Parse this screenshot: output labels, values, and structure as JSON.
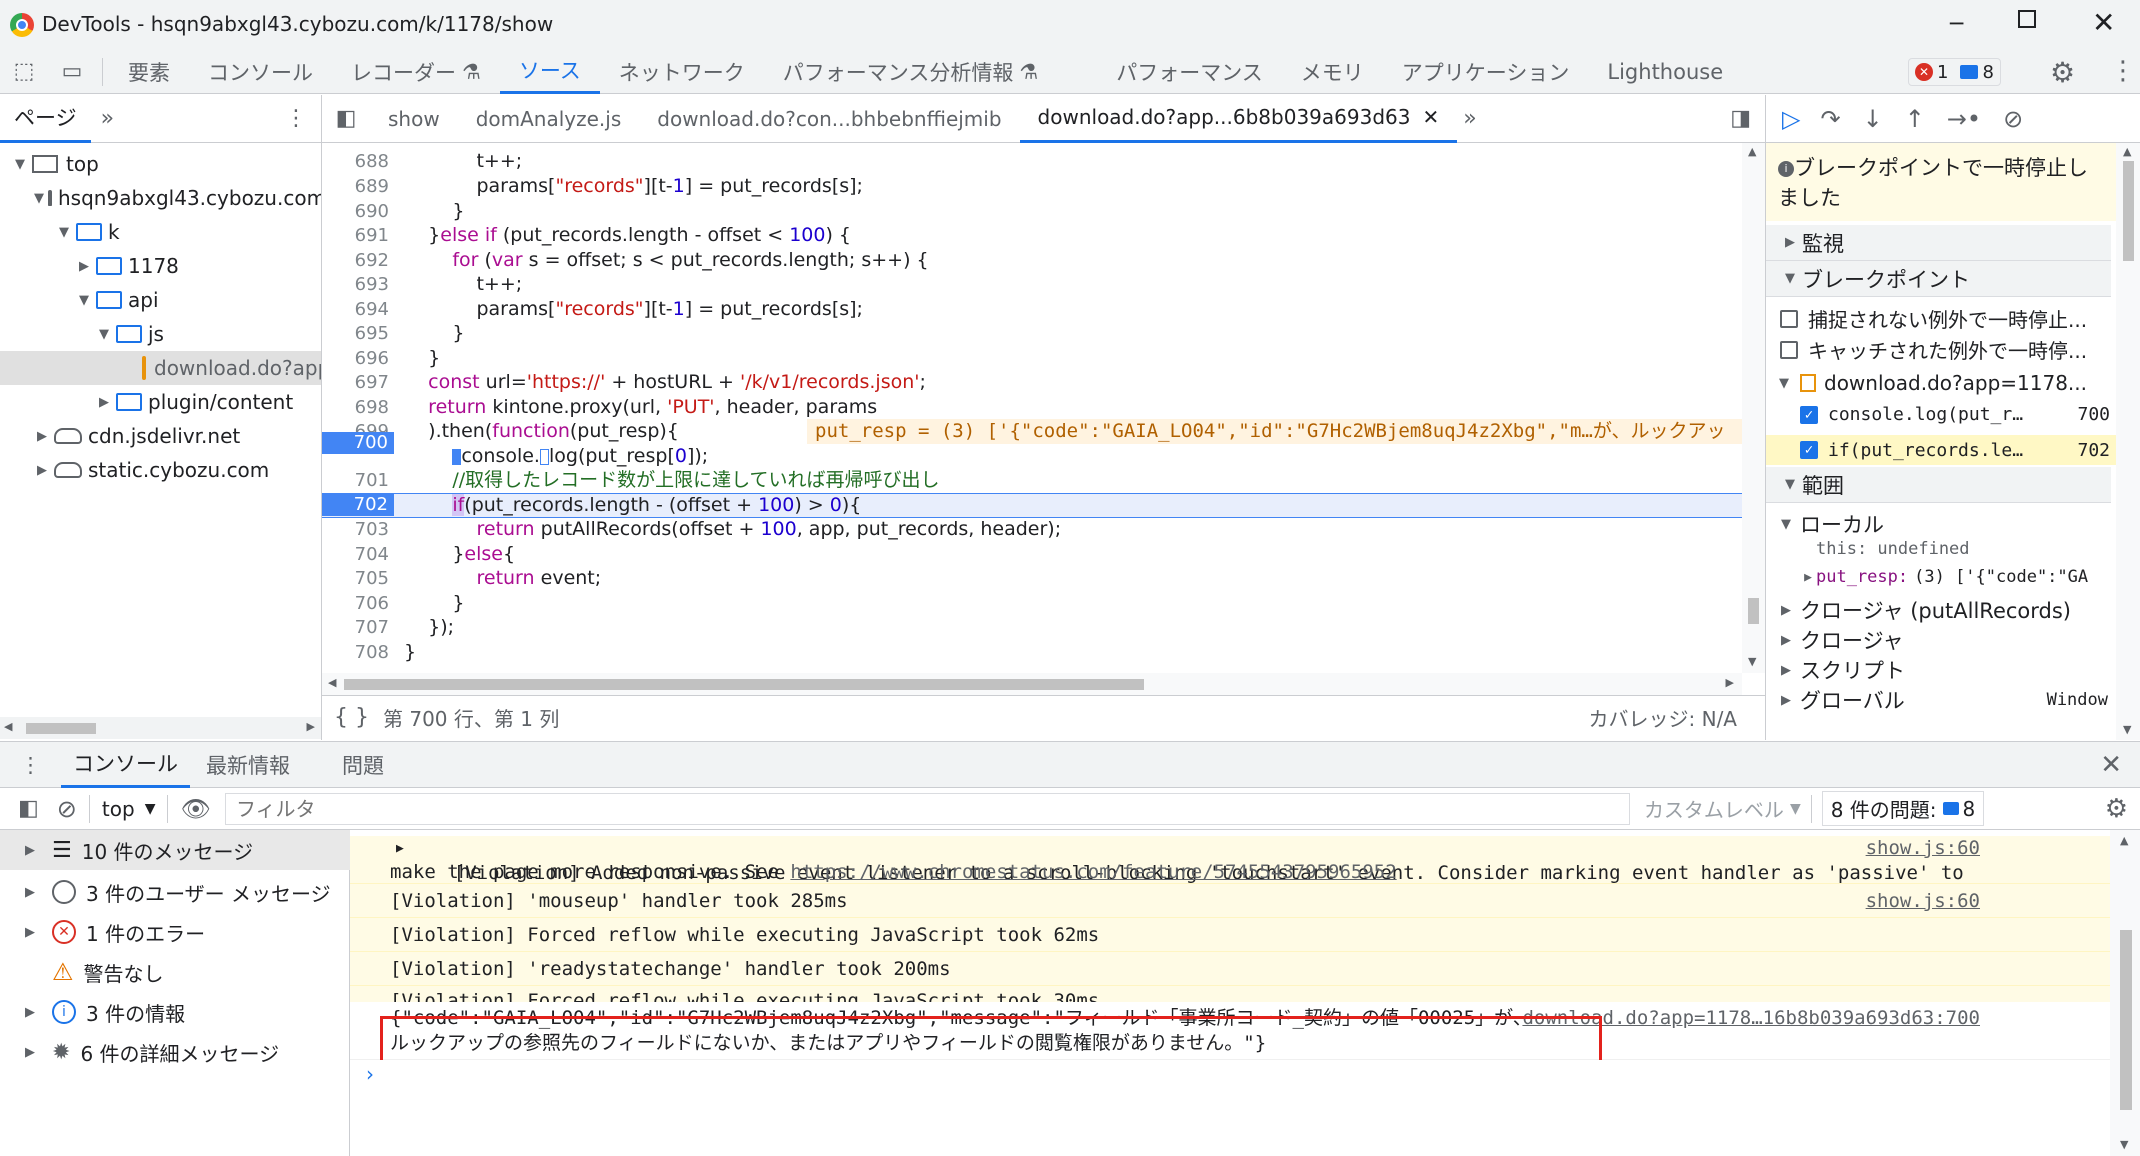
{
  "window": {
    "title": "DevTools - hsqn9abxgl43.cybozu.com/k/1178/show"
  },
  "main_tabs": [
    "要素",
    "コンソール",
    "レコーダー",
    "ソース",
    "ネットワーク",
    "パフォーマンス分析情報",
    "パフォーマンス",
    "メモリ",
    "アプリケーション",
    "Lighthouse"
  ],
  "active_main_tab": "ソース",
  "badges": {
    "errors": "1",
    "issues": "8"
  },
  "left": {
    "tab": "ページ",
    "tree": [
      "top",
      "hsqn9abxgl43.cybozu.com",
      "k",
      "1178",
      "api",
      "js",
      "download.do?app",
      "plugin/content",
      "cdn.jsdelivr.net",
      "static.cybozu.com"
    ]
  },
  "editor": {
    "tabs": [
      "show",
      "domAnalyze.js",
      "download.do?con...bhbebnffiejmib",
      "download.do?app...6b8b039a693d63"
    ],
    "active_tab": "download.do?app...6b8b039a693d63",
    "line_numbers": [
      "688",
      "689",
      "690",
      "691",
      "692",
      "693",
      "694",
      "695",
      "696",
      "697",
      "698",
      "699",
      "700",
      "701",
      "702",
      "703",
      "704",
      "705",
      "706",
      "707",
      "708"
    ],
    "inline_value": "put_resp = (3) ['{\"code\":\"GAIA_LO04\",\"id\":\"G7Hc2WBjem8uqJ4z2Xbg\",\"m…が、ルックアッ",
    "status": "第 700 行、第 1 列",
    "coverage": "カバレッジ: N/A"
  },
  "debug": {
    "paused": "ブレークポイントで一時停止しました",
    "watch": "監視",
    "breakpoints": "ブレークポイント",
    "uncaught": "捕捉されない例外で一時停止...",
    "caught": "キャッチされた例外で一時停...",
    "bp_file": "download.do?app=1178...",
    "bp1": "console.log(put_r…",
    "bp1_line": "700",
    "bp2": "if(put_records.le…",
    "bp2_line": "702",
    "scope": "範囲",
    "local": "ローカル",
    "this_val": "this: undefined",
    "put_resp_key": "put_resp:",
    "put_resp_val": "(3) ['{\"code\":\"GA",
    "closure1": "クロージャ (putAllRecords)",
    "closure2": "クロージャ",
    "script": "スクリプト",
    "global": "グローバル",
    "global_val": "Window"
  },
  "console": {
    "tabs": [
      "コンソール",
      "最新情報",
      "問題"
    ],
    "context": "top",
    "filter_placeholder": "フィルタ",
    "levels": "カスタムレベル",
    "issues": "8 件の問題:",
    "issues_count": "8",
    "side": [
      "10 件のメッセージ",
      "3 件のユーザー メッセージ",
      "1 件のエラー",
      "警告なし",
      "3 件の情報",
      "6 件の詳細メッセージ"
    ],
    "messages": [
      {
        "text": "[Violation] Added non-passive event listener to a scroll-blocking 'touchstart' event. Consider marking event handler as 'passive' to",
        "text2": "make the page more responsive. See ",
        "link": "https://www.chromestatus.com/feature/5745543795965952",
        "src": "show.js:60"
      },
      {
        "text": "[Violation] 'mouseup' handler took 285ms",
        "src": "show.js:60"
      },
      {
        "text": "[Violation] Forced reflow while executing JavaScript took 62ms"
      },
      {
        "text": "[Violation] 'readystatechange' handler took 200ms"
      },
      {
        "text": "[Violation] Forced reflow while executing JavaScript took 30ms"
      }
    ],
    "log_line1": "{\"code\":\"GAIA_LO04\",\"id\":\"G7Hc2WBjem8uqJ4z2Xbg\",\"message\":\"フィールド「事業所コード_契約」の値「00025」が、",
    "log_line2": "ルックアップの参照先のフィールドにないか、またはアプリやフィールドの閲覧権限がありません。\"}",
    "log_src": "download.do?app=1178…16b8b039a693d63:700"
  }
}
